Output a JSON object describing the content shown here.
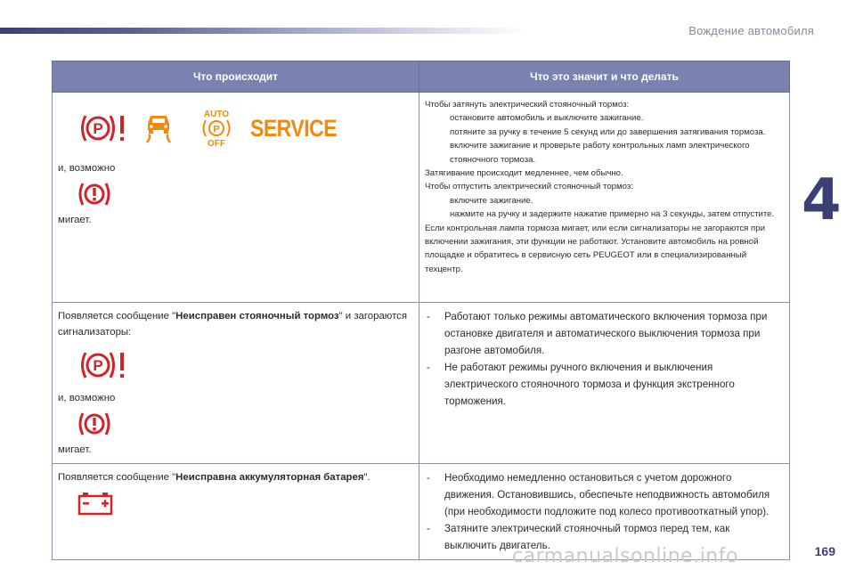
{
  "header": {
    "section_title": "Вождение автомобиля",
    "chapter_number": "4",
    "page_number": "169",
    "watermark": "carmanualsonline.info"
  },
  "table": {
    "col_left_header": "Что происходит",
    "col_right_header": "Что это значит и что делать",
    "row1": {
      "service_text": "SERVICE",
      "auto_label": "AUTO",
      "off_label": "OFF",
      "or_possibly": "и, возможно",
      "blinks": "мигает.",
      "lines": [
        {
          "type": "text",
          "text": "Чтобы затянуть электрический стояночный тормоз:"
        },
        {
          "type": "bullet",
          "text": "остановите автомобиль и выключите зажигание."
        },
        {
          "type": "bullet",
          "text": "потяните за ручку в течение 5 секунд или до завершения затягивания тормоза."
        },
        {
          "type": "bullet",
          "text": "включите зажигание и проверьте работу контрольных ламп электрического стояночного тормоза."
        },
        {
          "type": "text",
          "text": "Затягивание происходит медленнее, чем обычно."
        },
        {
          "type": "text",
          "text": "Чтобы отпустить электрический стояночный тормоз:"
        },
        {
          "type": "bullet",
          "text": "включите зажигание."
        },
        {
          "type": "bullet",
          "text": "нажмите на ручку и задержите нажатие примерно на 3 секунды, затем отпустите."
        },
        {
          "type": "text",
          "text": "Если контрольная лампа тормоза мигает, или если сигнализаторы не загораются при включении зажигания, эти функции не работают. Установите автомобиль на ровной площадке и обратитесь в сервисную сеть PEUGEOT или в специализированный техцентр."
        }
      ]
    },
    "row2": {
      "msg_before": "Появляется сообщение \"",
      "msg_bold": "Неисправен стояночный тормоз",
      "msg_after": "\" и загораются сигнализаторы:",
      "or_possibly": "и, возможно",
      "blinks": "мигает.",
      "items": [
        "Работают только режимы автоматического включения тормоза при остановке двигателя и автоматического выключения тормоза при разгоне автомобиля.",
        "Не работают режимы ручного включения и выключения электрического стояночного тормоза и функция экстренного торможения."
      ]
    },
    "row3": {
      "msg_before": "Появляется сообщение \"",
      "msg_bold": "Неисправна аккумуляторная батарея",
      "msg_after": "\".",
      "items": [
        "Необходимо немедленно остановиться с учетом дорожного движения. Остановившись, обеспечьте неподвижность автомобиля (при необходимости подложите под колесо противооткатный упор).",
        "Затяните электрический стояночный тормоз перед тем, как выключить двигатель."
      ]
    },
    "bullet_glyph": "",
    "dash_glyph": "-",
    "colors": {
      "header_bg": "#7a82b0",
      "border": "#8c8fb0",
      "red": "#d2232a",
      "orange": "#f08a10"
    },
    "icons": [
      "parking-brake-fault-icon",
      "esp-skid-icon",
      "auto-park-off-icon",
      "service-warning-icon",
      "brake-fault-icon",
      "battery-icon"
    ]
  }
}
